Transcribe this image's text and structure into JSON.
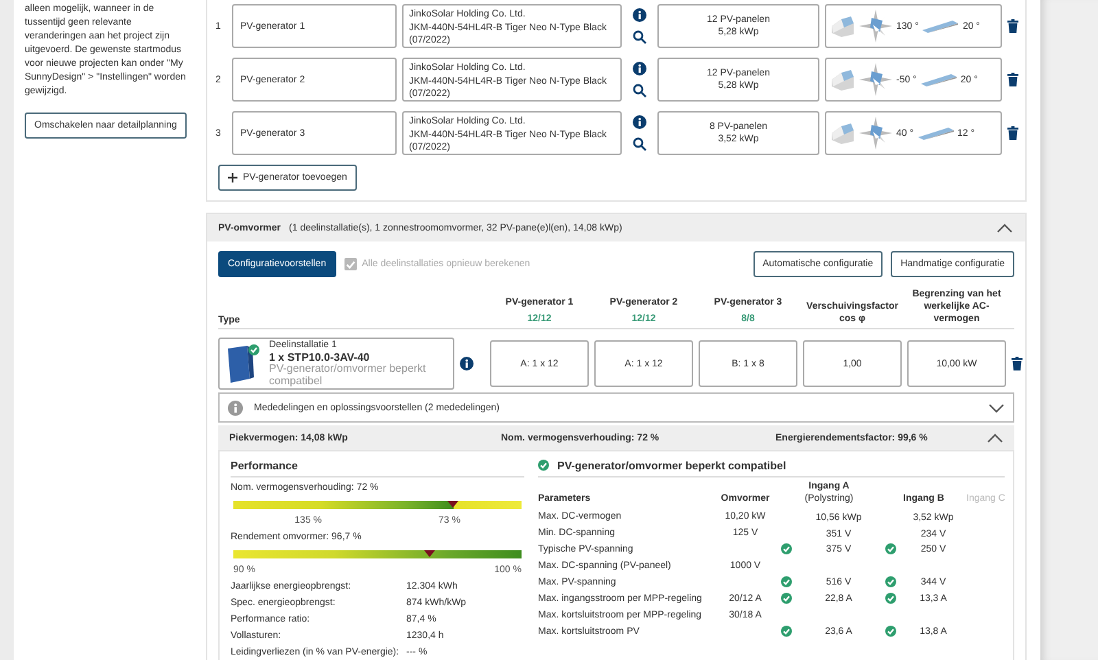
{
  "sidebar": {
    "text": "alleen mogelijk, wanneer in de tussentijd geen relevante veranderingen aan het project zijn uitgevoerd. De gewenste startmodus voor nieuwe projecten kan onder \"My SunnyDesign\" > \"Instellingen\" worden gewijzigd.",
    "button": "Omschakelen naar detailplanning"
  },
  "generators": {
    "rows": [
      {
        "number": "1",
        "name": "PV-generator 1",
        "module": [
          "JinkoSolar Holding Co. Ltd.",
          "JKM-440N-54HL4R-B Tiger Neo N-Type Black",
          "(07/2022)"
        ],
        "panels": "12 PV-panelen",
        "power": "5,28 kWp",
        "azimuth": "130 °",
        "tilt": "20 °"
      },
      {
        "number": "2",
        "name": "PV-generator 2",
        "module": [
          "JinkoSolar Holding Co. Ltd.",
          "JKM-440N-54HL4R-B Tiger Neo N-Type Black",
          "(07/2022)"
        ],
        "panels": "12 PV-panelen",
        "power": "5,28 kWp",
        "azimuth": "-50 °",
        "tilt": "20 °"
      },
      {
        "number": "3",
        "name": "PV-generator 3",
        "module": [
          "JinkoSolar Holding Co. Ltd.",
          "JKM-440N-54HL4R-B Tiger Neo N-Type Black",
          "(07/2022)"
        ],
        "panels": "8 PV-panelen",
        "power": "3,52 kWp",
        "azimuth": "40 °",
        "tilt": "12 °"
      }
    ],
    "add_button": "PV-generator toevoegen"
  },
  "inverter": {
    "title": "PV-omvormer",
    "summary": "(1 deelinstallatie(s), 1 zonnestroomomvormer, 32 PV-pane(e)l(en), 14,08 kWp)",
    "expanded": true,
    "propose_button": "Configuratievoorstellen",
    "recalc": {
      "label": "Alle deelinstallaties opnieuw berekenen",
      "checked": true,
      "disabled": true
    },
    "buttons": [
      "Automatische configuratie",
      "Handmatige configuratie"
    ],
    "type_header": "Type",
    "columns": [
      {
        "name": "PV-generator 1",
        "count": "12/12"
      },
      {
        "name": "PV-generator 2",
        "count": "12/12"
      },
      {
        "name": "PV-generator 3",
        "count": "8/8"
      },
      {
        "name": "Verschuivingsfactor cos φ"
      },
      {
        "name": "Begrenzing van het werkelijke AC-vermogen"
      }
    ],
    "row": {
      "subsystem": "Deelinstallatie 1",
      "model": "1 x STP10.0-3AV-40",
      "status": "PV-generator/omvormer beperkt compatibel",
      "cells": [
        "A: 1 x 12",
        "A: 1 x 12",
        "B: 1 x 8",
        "1,00",
        "10,00 kW"
      ]
    },
    "messages": {
      "label": "Mededelingen en oplossingsvoorstellen (2 mededelingen)",
      "expanded": false
    },
    "results": {
      "expanded": true,
      "stats": [
        "Piekvermogen: 14,08 kWp",
        "Nom. vermogensverhouding: 72 %",
        "Energierendementsfactor: 99,6 %"
      ],
      "performance": {
        "title": "Performance",
        "meters": [
          {
            "kind": "ratio",
            "label": "Nom. vermogensverhouding: 72 %",
            "level": 0.76,
            "ticks": [
              "135 %",
              "73 %"
            ]
          },
          {
            "kind": "efficiency",
            "label": "Rendement omvormer: 96,7 %",
            "level": 0.68,
            "ticks": [
              "90 %",
              "100 %"
            ]
          }
        ],
        "figures": [
          {
            "label": "Jaarlijkse energieopbrengst:",
            "value": "12.304 kWh"
          },
          {
            "label": "Spec. energieopbrengst:",
            "value": "874 kWh/kWp"
          },
          {
            "label": "Performance ratio:",
            "value": "87,4 %"
          },
          {
            "label": "Vollasturen:",
            "value": "1230,4  h"
          },
          {
            "label": "Leidingverliezen (in % van PV-energie):",
            "value": "--- %"
          }
        ]
      },
      "compatibility": {
        "title": "PV-generator/omvormer beperkt compatibel",
        "columns": [
          {
            "name": "Parameters",
            "disabled": false
          },
          {
            "name": "Omvormer",
            "disabled": false
          },
          {
            "name": "Ingang A",
            "note": "(Polystring)",
            "disabled": false
          },
          {
            "name": "Ingang B",
            "disabled": false
          },
          {
            "name": "Ingang C",
            "disabled": true
          }
        ],
        "rows": [
          {
            "name": "Max. DC-vermogen",
            "inverter": "10,20 kW",
            "a": {
              "value": "10,56 kWp",
              "ok": false
            },
            "b": {
              "value": "3,52 kWp",
              "ok": false
            }
          },
          {
            "name": "Min. DC-spanning",
            "inverter": "125 V",
            "a": {
              "value": "351 V",
              "ok": false
            },
            "b": {
              "value": "234 V",
              "ok": false
            }
          },
          {
            "name": "Typische PV-spanning",
            "a": {
              "value": "375 V",
              "ok": true
            },
            "b": {
              "value": "250 V",
              "ok": true
            }
          },
          {
            "name": "Max. DC-spanning (PV-paneel)",
            "inverter": "1000 V"
          },
          {
            "name": "Max. PV-spanning",
            "a": {
              "value": "516 V",
              "ok": true
            },
            "b": {
              "value": "344 V",
              "ok": true
            }
          },
          {
            "name": "Max. ingangsstroom per MPP-regeling",
            "inverter": "20/12 A",
            "a": {
              "value": "22,8 A",
              "ok": true
            },
            "b": {
              "value": "13,3 A",
              "ok": true
            }
          },
          {
            "name": "Max. kortsluitstroom per MPP-regeling",
            "inverter": "30/18 A"
          },
          {
            "name": "Max. kortsluitstroom PV",
            "a": {
              "value": "23,6 A",
              "ok": true
            },
            "b": {
              "value": "13,8 A",
              "ok": true
            }
          }
        ]
      }
    }
  }
}
